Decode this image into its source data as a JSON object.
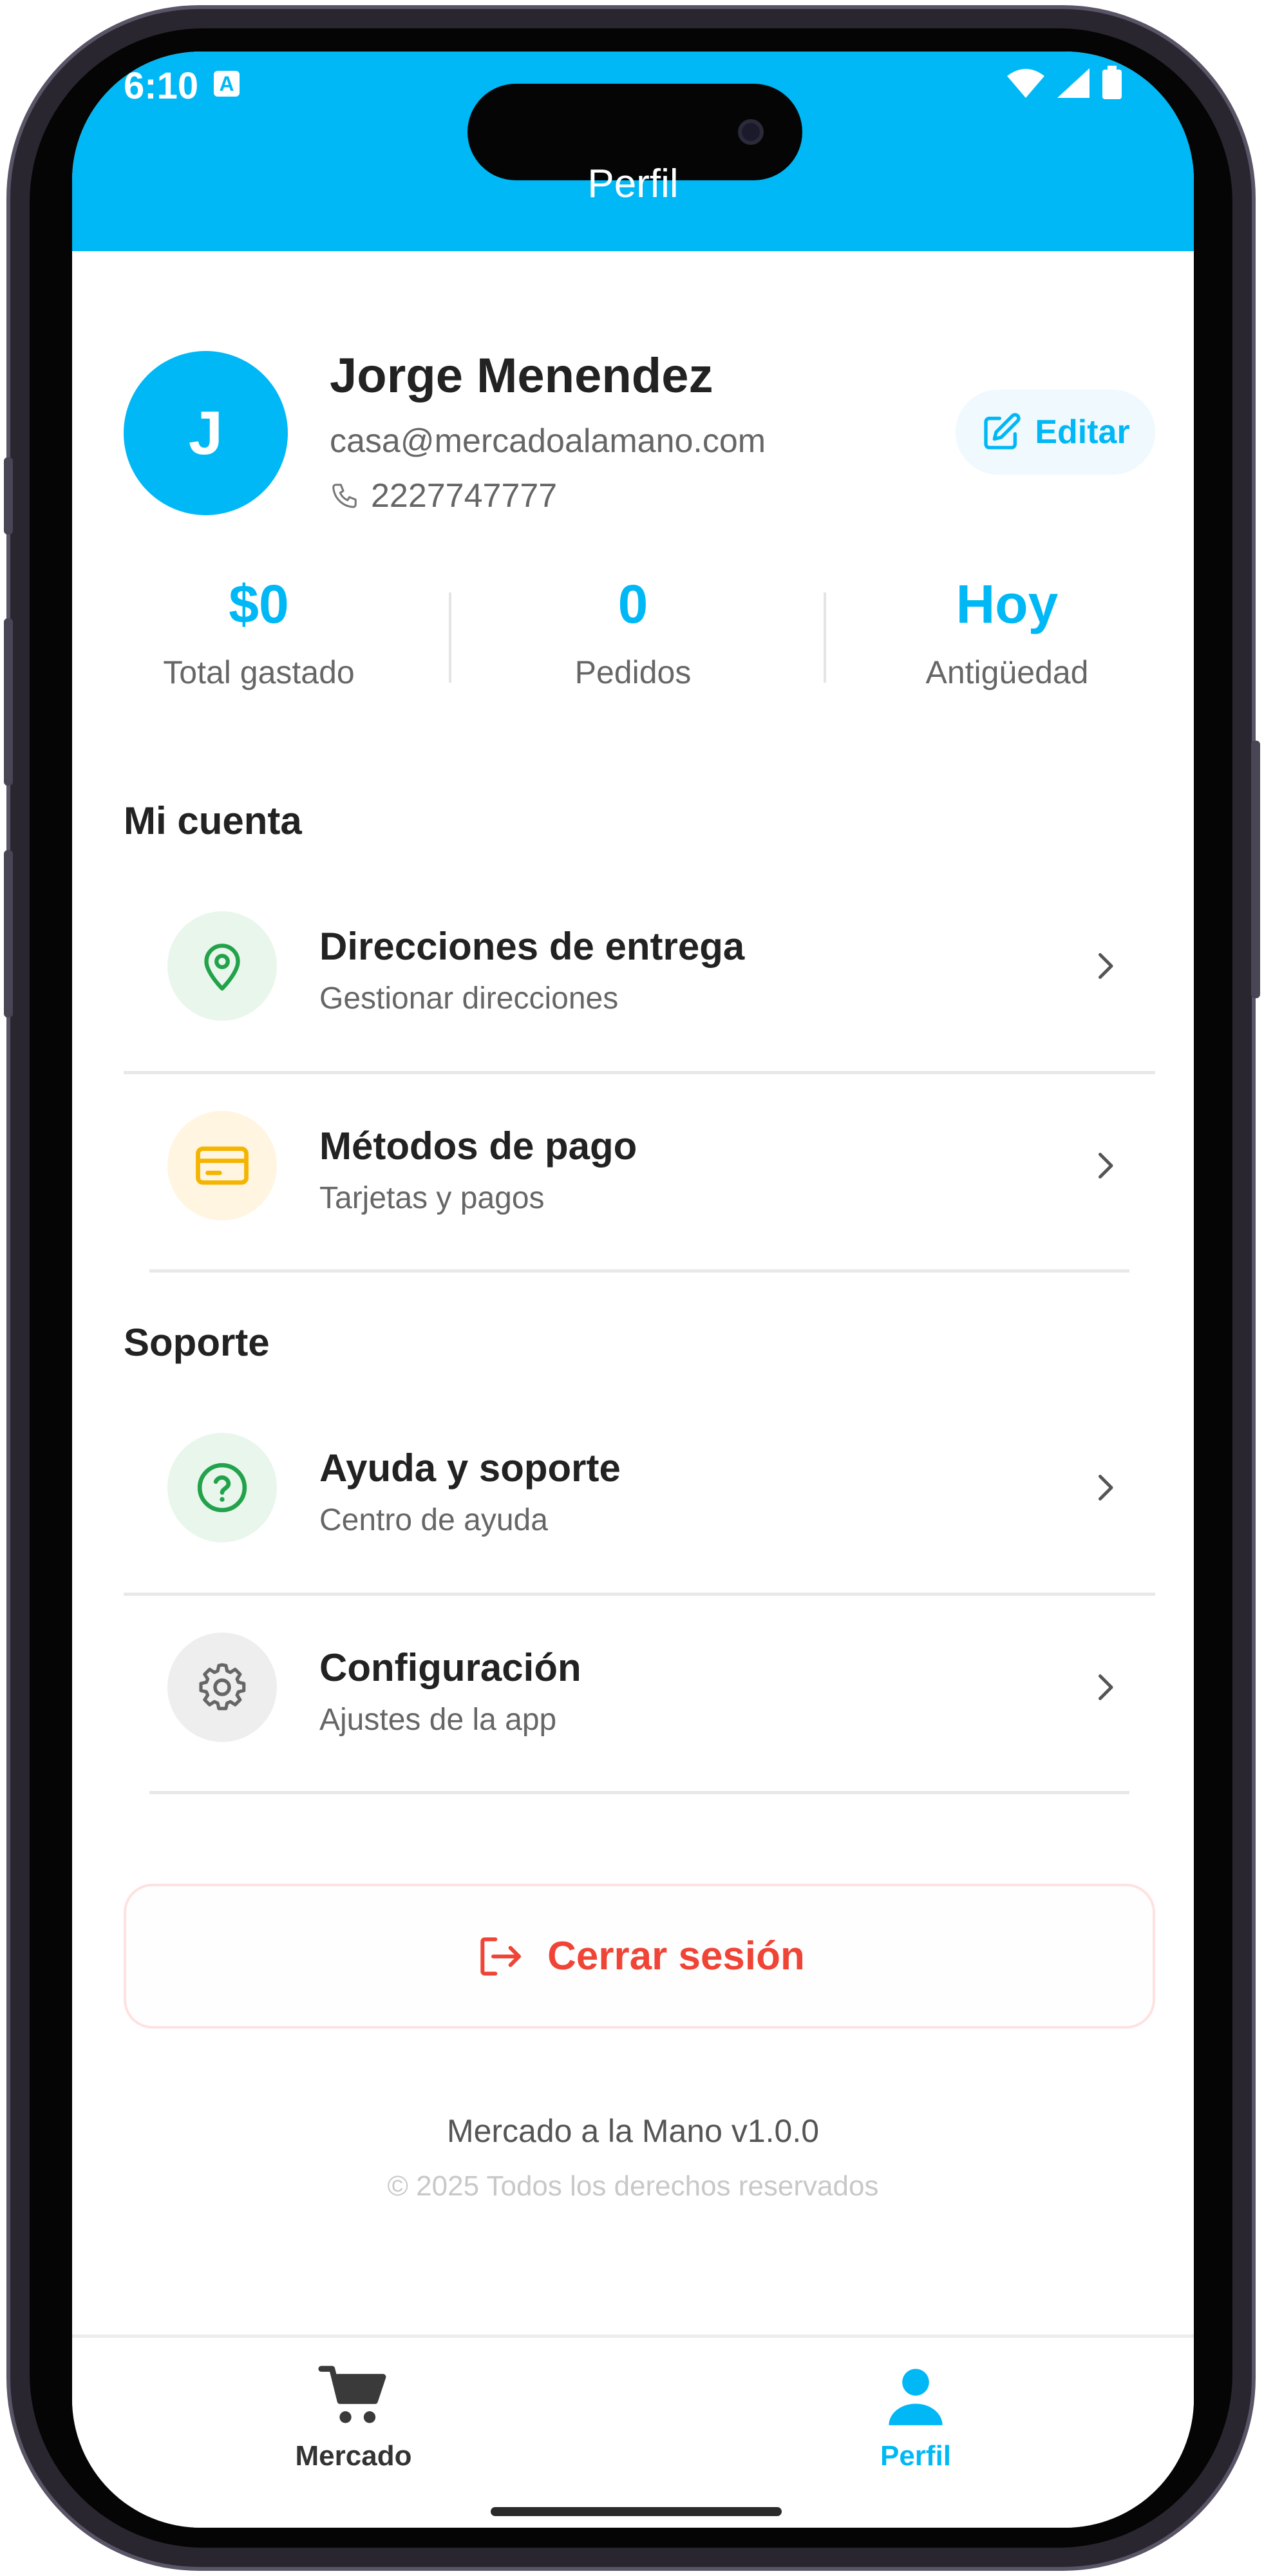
{
  "status_bar": {
    "time": "6:10",
    "badge": "A"
  },
  "app_bar": {
    "title": "Perfil"
  },
  "profile": {
    "initial": "J",
    "name": "Jorge Menendez",
    "email": "casa@mercadoalamano.com",
    "phone": "2227747777",
    "edit_label": "Editar"
  },
  "stats": [
    {
      "value": "$0",
      "label": "Total gastado"
    },
    {
      "value": "0",
      "label": "Pedidos"
    },
    {
      "value": "Hoy",
      "label": "Antigüedad"
    }
  ],
  "sections": {
    "account": {
      "title": "Mi cuenta",
      "items": [
        {
          "title": "Direcciones de entrega",
          "subtitle": "Gestionar direcciones",
          "icon": "location-pin-icon"
        },
        {
          "title": "Métodos de pago",
          "subtitle": "Tarjetas y pagos",
          "icon": "credit-card-icon"
        }
      ]
    },
    "support": {
      "title": "Soporte",
      "items": [
        {
          "title": "Ayuda y soporte",
          "subtitle": "Centro de ayuda",
          "icon": "help-circle-icon"
        },
        {
          "title": "Configuración",
          "subtitle": "Ajustes de la app",
          "icon": "gear-icon"
        }
      ]
    }
  },
  "logout_label": "Cerrar sesión",
  "footer": {
    "version": "Mercado a la Mano v1.0.0",
    "copyright": "© 2025 Todos los derechos reservados"
  },
  "bottom_nav": [
    {
      "label": "Mercado",
      "icon": "cart-icon",
      "active": false
    },
    {
      "label": "Perfil",
      "icon": "person-icon",
      "active": true
    }
  ],
  "colors": {
    "primary": "#00b8f5",
    "danger": "#ef4436",
    "text": "#222222",
    "muted": "#666666"
  }
}
